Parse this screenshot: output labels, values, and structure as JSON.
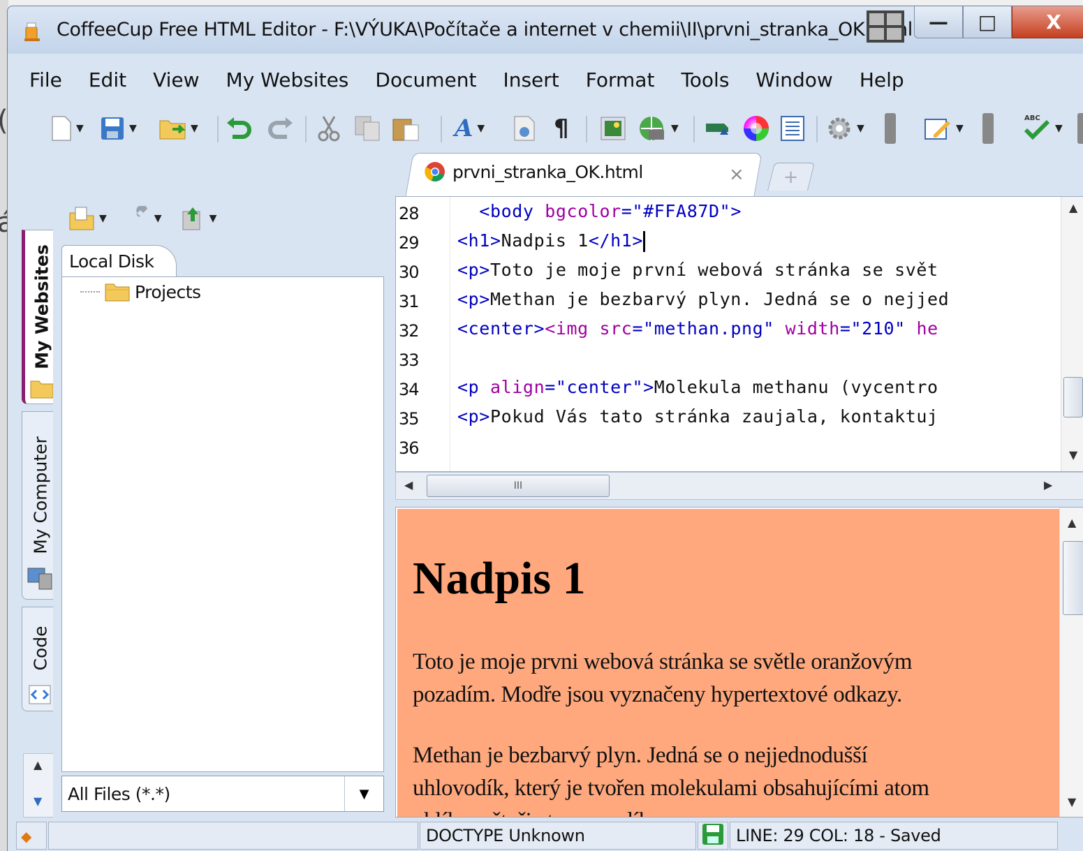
{
  "outside": {
    "chars": [
      "(",
      "á"
    ]
  },
  "window": {
    "title": "CoffeeCup Free HTML Editor - F:\\VÝUKA\\Počítače a internet v chemii\\II\\prvni_stranka_OK.html",
    "buttons": {
      "minimize": "—",
      "maximize": "□",
      "close": "X"
    }
  },
  "menu": [
    {
      "label": "File"
    },
    {
      "label": "Edit"
    },
    {
      "label": "View"
    },
    {
      "label": "My Websites"
    },
    {
      "label": "Document"
    },
    {
      "label": "Insert"
    },
    {
      "label": "Format"
    },
    {
      "label": "Tools"
    },
    {
      "label": "Window"
    },
    {
      "label": "Help"
    }
  ],
  "toolbar": {
    "icons": [
      "new-file-icon",
      "save-icon",
      "open-icon",
      "undo-icon",
      "redo-icon",
      "cut-icon",
      "copy-icon",
      "paste-icon",
      "font-icon",
      "spellcheck-doc-icon",
      "paragraph-icon",
      "image-icon",
      "web-icon",
      "link-icon",
      "color-icon",
      "list-icon",
      "settings-icon",
      "edit-icon",
      "abc-check-icon"
    ],
    "paragraph_glyph": "¶",
    "font_glyph": "A",
    "abc_label": "ABC"
  },
  "tab": {
    "title": "prvni_stranka_OK.html",
    "close": "×",
    "new": "+"
  },
  "sidebar": {
    "tabs": [
      {
        "label": "My Websites"
      },
      {
        "label": "My Computer"
      },
      {
        "label": "Code"
      }
    ],
    "panel_tab": "Local Disk",
    "tree": [
      {
        "label": "Projects"
      }
    ],
    "filter": "All Files (*.*)"
  },
  "editor": {
    "lines": [
      28,
      29,
      30,
      31,
      32,
      33,
      34,
      35,
      36
    ],
    "code": {
      "l28_indent": "  ",
      "l28_tag_open": "<body ",
      "l28_attr": "bgcolor",
      "l28_eq": "=",
      "l28_val": "\"#FFA87D\"",
      "l28_tag_close": ">",
      "l29_open": "<h1>",
      "l29_text": "Nadpis 1",
      "l29_close": "</h1>",
      "l30_open": "<p>",
      "l30_text": "Toto je moje první webová stránka se svět",
      "l31_open": "<p>",
      "l31_text": "Methan je bezbarvý plyn. Jedná se o nejjed",
      "l32_tag1": "<center>",
      "l32_tag2": "<img ",
      "l32_attr1": "src",
      "l32_val1": "\"methan.png\"",
      "l32_attr2": "width",
      "l32_val2": "\"210\"",
      "l32_attr3": "he",
      "l34_tag": "<p ",
      "l34_attr": "align",
      "l34_val": "\"center\"",
      "l34_close": ">",
      "l34_text": "Molekula methanu (vycentro",
      "l35_open": "<p>",
      "l35_text": "Pokud Vás tato stránka zaujala, kontaktuj"
    },
    "hscroll_grip": "III"
  },
  "preview": {
    "background": "#FFA87D",
    "h1": "Nadpis 1",
    "p1_line1": "Toto je moje prvni webová stránka se světle oranžovým",
    "p1_line2": "pozadím. Modře jsou vyznačeny hypertextové odkazy.",
    "p2_line1": "Methan je bezbarvý plyn. Jedná se o nejjednodušší",
    "p2_line2": "uhlovodík, který je tvořen molekulami obsahujícími atom",
    "p2_line3": "uhlíku a čtyři atomy vodíku"
  },
  "status": {
    "doctype": "DOCTYPE Unknown",
    "position": "LINE: 29  COL: 18 - Saved"
  }
}
